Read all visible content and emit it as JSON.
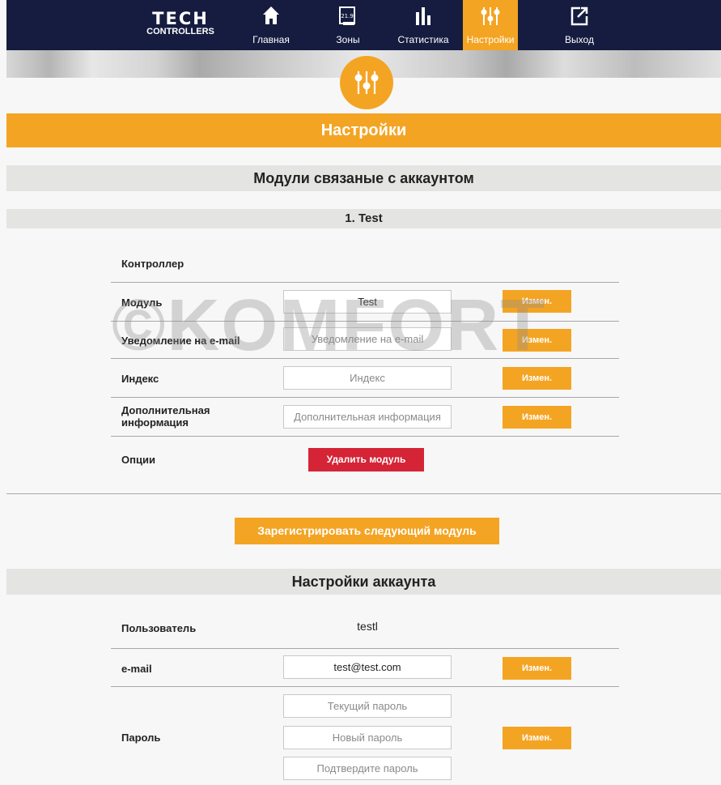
{
  "header": {
    "logo_top": "TECH",
    "logo_bottom": "CONTROLLERS",
    "nav": [
      {
        "label": "Главная",
        "icon": "home-icon"
      },
      {
        "label": "Зоны",
        "icon": "zones-icon",
        "icon_text": "21.9"
      },
      {
        "label": "Статистика",
        "icon": "statistics-icon"
      },
      {
        "label": "Настройки",
        "icon": "settings-sliders-icon",
        "active": true
      },
      {
        "label": "Выход",
        "icon": "exit-icon"
      }
    ]
  },
  "page_title": "Настройки",
  "modules_section": {
    "title": "Модули связаные с аккаунтом",
    "module_header": "1. Test",
    "controller_label": "Контроллер",
    "rows": [
      {
        "label": "Модуль",
        "value": "Test",
        "placeholder": "",
        "button": "Измен."
      },
      {
        "label": "Уведомление на e-mail",
        "value": "",
        "placeholder": "Уведомление на e-mail",
        "button": "Измен."
      },
      {
        "label": "Индекс",
        "value": "",
        "placeholder": "Индекс",
        "button": "Измен."
      },
      {
        "label": "Дополнительная информация",
        "value": "",
        "placeholder": "Дополнительная информация",
        "button": "Измен."
      }
    ],
    "options_label": "Опции",
    "delete_button": "Удалить модуль",
    "register_button": "Зарегистрировать следующий модуль"
  },
  "watermark": "©KOMFORT",
  "account_section": {
    "title": "Настройки аккаунта",
    "user_label": "Пользователь",
    "user_value": "testl",
    "email_label": "e-mail",
    "email_value": "test@test.com",
    "email_button": "Измен.",
    "password_label": "Пароль",
    "password_current_placeholder": "Текущий пароль",
    "password_new_placeholder": "Новый пароль",
    "password_confirm_placeholder": "Подтвердите пароль",
    "password_button": "Измен."
  },
  "colors": {
    "navbar": "#151c3f",
    "accent": "#f4a423",
    "danger": "#d42436",
    "section_bar": "#e4e4e2"
  }
}
